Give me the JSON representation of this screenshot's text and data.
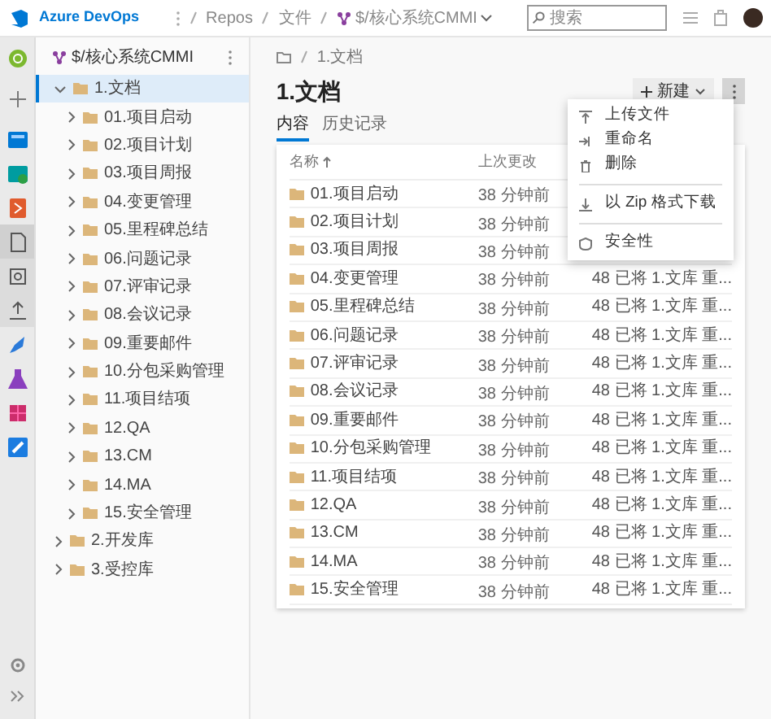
{
  "header": {
    "product": "Azure DevOps",
    "breadcrumbs": [
      "Repos",
      "文件"
    ],
    "repo": "$/核心系统CMMI",
    "search": {
      "placeholder": "搜索"
    }
  },
  "nav": [
    {
      "kind": "project",
      "selected": false
    },
    {
      "kind": "add",
      "selected": false
    },
    {
      "kind": "boards",
      "selected": false
    },
    {
      "kind": "board-check",
      "selected": false
    },
    {
      "kind": "repos",
      "selected": false
    },
    {
      "kind": "files",
      "selected": true
    },
    {
      "kind": "commits",
      "selected": false
    },
    {
      "kind": "pushes",
      "selected": false
    },
    {
      "kind": "pipelines",
      "selected": false
    },
    {
      "kind": "test",
      "selected": false
    },
    {
      "kind": "artifacts",
      "selected": false
    },
    {
      "kind": "link",
      "selected": false
    }
  ],
  "tree": {
    "title": "$/核心系统CMMI",
    "items": [
      {
        "label": "1.文档",
        "selected": true,
        "expanded": true,
        "children": [
          {
            "label": "01.项目启动",
            "selected": false,
            "expanded": false
          },
          {
            "label": "02.项目计划",
            "selected": false,
            "expanded": false
          },
          {
            "label": "03.项目周报",
            "selected": false,
            "expanded": false
          },
          {
            "label": "04.变更管理",
            "selected": false,
            "expanded": false
          },
          {
            "label": "05.里程碑总结",
            "selected": false,
            "expanded": false
          },
          {
            "label": "06.问题记录",
            "selected": false,
            "expanded": false
          },
          {
            "label": "07.评审记录",
            "selected": false,
            "expanded": false
          },
          {
            "label": "08.会议记录",
            "selected": false,
            "expanded": false
          },
          {
            "label": "09.重要邮件",
            "selected": false,
            "expanded": false
          },
          {
            "label": "10.分包采购管理",
            "selected": false,
            "expanded": false
          },
          {
            "label": "11.项目结项",
            "selected": false,
            "expanded": false
          },
          {
            "label": "12.QA",
            "selected": false,
            "expanded": false
          },
          {
            "label": "13.CM",
            "selected": false,
            "expanded": false
          },
          {
            "label": "14.MA",
            "selected": false,
            "expanded": false
          },
          {
            "label": "15.安全管理",
            "selected": false,
            "expanded": false
          }
        ]
      },
      {
        "label": "2.开发库",
        "selected": false,
        "expanded": false
      },
      {
        "label": "3.受控库",
        "selected": false,
        "expanded": false
      }
    ]
  },
  "main": {
    "path": "1.文档",
    "title": "1.文档",
    "new_button": "新建",
    "tabs": [
      {
        "label": "内容",
        "selected": true
      },
      {
        "label": "历史记录",
        "selected": false
      }
    ],
    "table": {
      "columns": [
        {
          "label": "名称",
          "sorted": true
        },
        {
          "label": "上次更改",
          "sorted": false
        }
      ],
      "rows": [
        {
          "name": "01.项目启动",
          "changed": "38 分钟前"
        },
        {
          "name": "02.项目计划",
          "changed": "38 分钟前"
        },
        {
          "name": "03.项目周报",
          "changed": "38 分钟前"
        },
        {
          "name": "04.变更管理",
          "changed": "38 分钟前",
          "commit": "48 已将 1.文库 重..."
        },
        {
          "name": "05.里程碑总结",
          "changed": "38 分钟前",
          "commit": "48 已将 1.文库 重..."
        },
        {
          "name": "06.问题记录",
          "changed": "38 分钟前",
          "commit": "48 已将 1.文库 重..."
        },
        {
          "name": "07.评审记录",
          "changed": "38 分钟前",
          "commit": "48 已将 1.文库 重..."
        },
        {
          "name": "08.会议记录",
          "changed": "38 分钟前",
          "commit": "48 已将 1.文库 重..."
        },
        {
          "name": "09.重要邮件",
          "changed": "38 分钟前",
          "commit": "48 已将 1.文库 重..."
        },
        {
          "name": "10.分包采购管理",
          "changed": "38 分钟前",
          "commit": "48 已将 1.文库 重..."
        },
        {
          "name": "11.项目结项",
          "changed": "38 分钟前",
          "commit": "48 已将 1.文库 重..."
        },
        {
          "name": "12.QA",
          "changed": "38 分钟前",
          "commit": "48 已将 1.文库 重..."
        },
        {
          "name": "13.CM",
          "changed": "38 分钟前",
          "commit": "48 已将 1.文库 重..."
        },
        {
          "name": "14.MA",
          "changed": "38 分钟前",
          "commit": "48 已将 1.文库 重..."
        },
        {
          "name": "15.安全管理",
          "changed": "38 分钟前",
          "commit": "48 已将 1.文库 重..."
        }
      ]
    }
  },
  "menu": {
    "groups": [
      [
        {
          "kind": "upload",
          "label": "上传文件"
        },
        {
          "kind": "rename",
          "label": "重命名"
        },
        {
          "kind": "delete",
          "label": "删除"
        }
      ],
      [
        {
          "kind": "download",
          "label": "以 Zip 格式下载"
        }
      ],
      [
        {
          "kind": "security",
          "label": "安全性"
        }
      ]
    ]
  }
}
